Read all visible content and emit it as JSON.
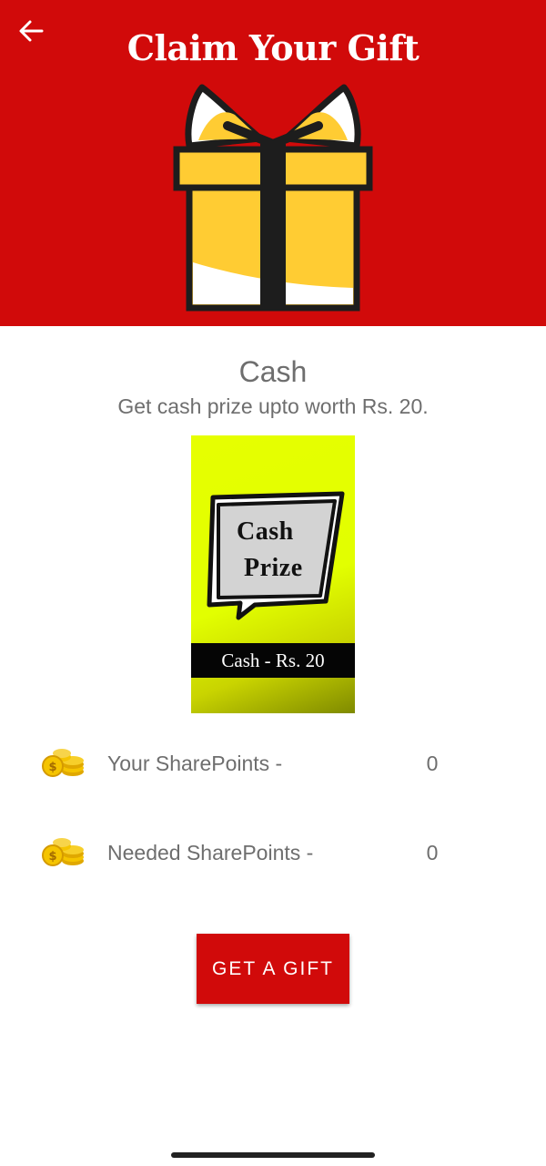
{
  "header": {
    "title": "Claim Your Gift",
    "back_icon": "arrow-left-icon",
    "background_color": "#d10a0a",
    "gift_icon": "gift-box-icon"
  },
  "gift": {
    "name": "Cash",
    "description": "Get cash prize upto worth Rs. 20.",
    "voucher": {
      "line1": "Cash",
      "line2": "Prize",
      "band_label": "Cash - Rs. 20"
    }
  },
  "points": [
    {
      "icon": "coins-icon",
      "label": "Your SharePoints -",
      "value": "0"
    },
    {
      "icon": "coins-icon",
      "label": "Needed SharePoints -",
      "value": "0"
    }
  ],
  "action": {
    "label": "GET A GIFT",
    "color": "#d10a0a"
  }
}
